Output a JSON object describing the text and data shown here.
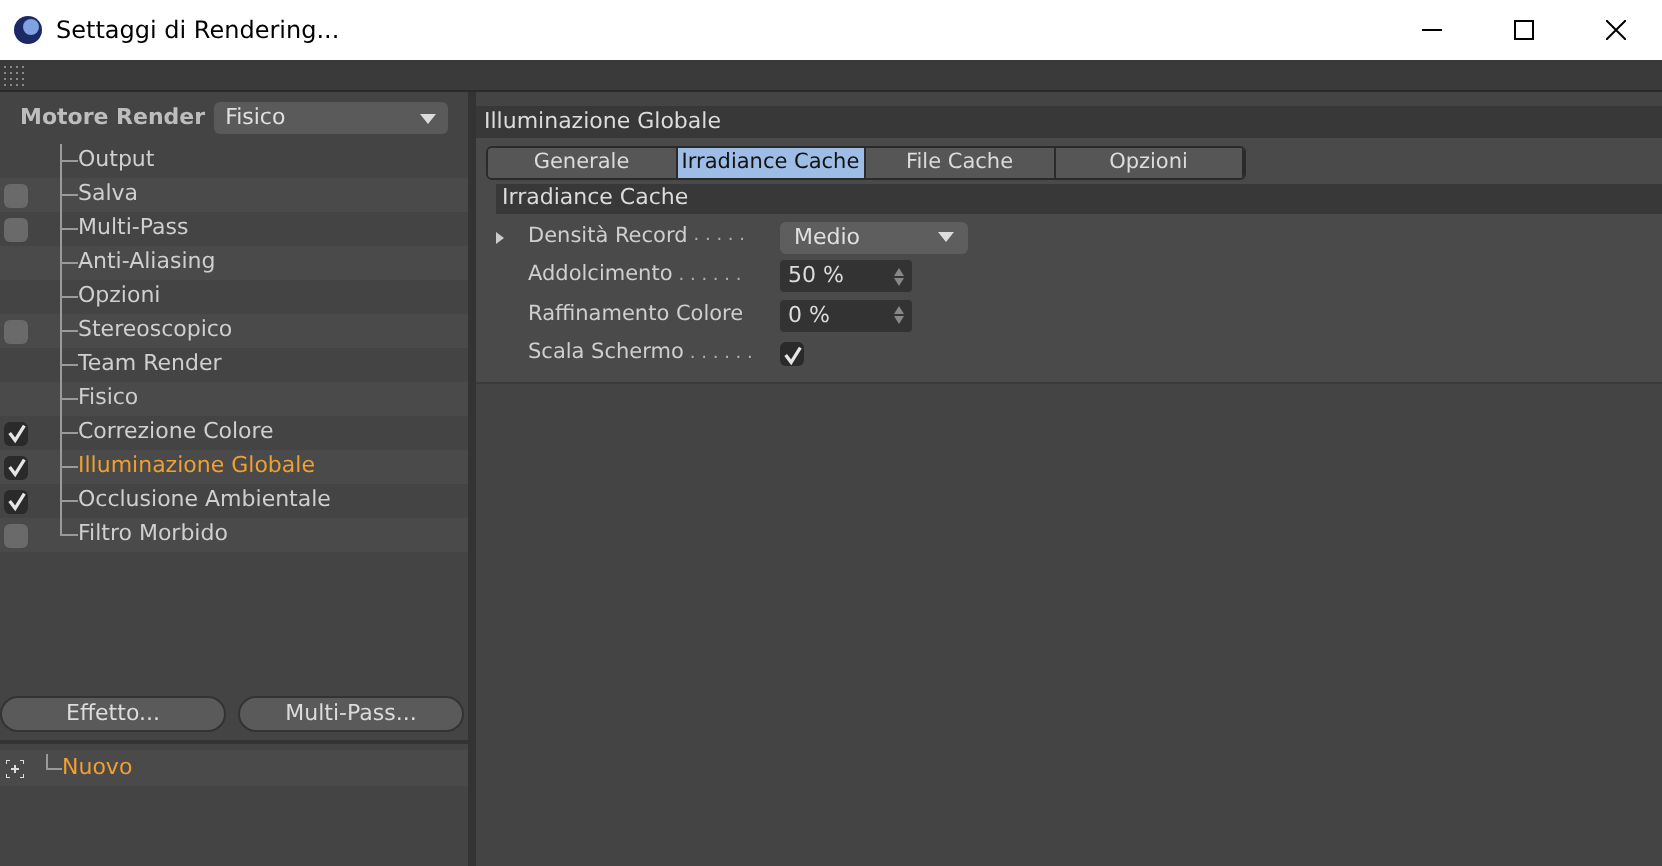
{
  "window": {
    "title": "Settaggi di Rendering..."
  },
  "renderer": {
    "label": "Motore Render",
    "value": "Fisico"
  },
  "tree": [
    {
      "label": "Output",
      "kind": "plain",
      "selected": false
    },
    {
      "label": "Salva",
      "kind": "check",
      "checked": false,
      "selected": false
    },
    {
      "label": "Multi-Pass",
      "kind": "check",
      "checked": false,
      "selected": false
    },
    {
      "label": "Anti-Aliasing",
      "kind": "plain",
      "selected": false
    },
    {
      "label": "Opzioni",
      "kind": "plain",
      "selected": false
    },
    {
      "label": "Stereoscopico",
      "kind": "check",
      "checked": false,
      "selected": false
    },
    {
      "label": "Team Render",
      "kind": "plain",
      "selected": false
    },
    {
      "label": "Fisico",
      "kind": "plain",
      "selected": false
    },
    {
      "label": "Correzione Colore",
      "kind": "check",
      "checked": true,
      "selected": false
    },
    {
      "label": "Illuminazione Globale",
      "kind": "check",
      "checked": true,
      "selected": true
    },
    {
      "label": "Occlusione Ambientale",
      "kind": "check",
      "checked": true,
      "selected": false
    },
    {
      "label": "Filtro Morbido",
      "kind": "check",
      "checked": false,
      "selected": false
    }
  ],
  "buttons": [
    "Effetto...",
    "Multi-Pass..."
  ],
  "presets": [
    {
      "label": "Nuovo"
    }
  ],
  "panel": {
    "title": "Illuminazione Globale",
    "tabs": [
      {
        "label": "Generale",
        "selected": false
      },
      {
        "label": "Irradiance Cache",
        "selected": true
      },
      {
        "label": "File Cache",
        "selected": false
      },
      {
        "label": "Opzioni",
        "selected": false
      }
    ],
    "section": "Irradiance Cache",
    "params": [
      {
        "kind": "dropdown",
        "label": "Densità Record",
        "dots": ". . . . .",
        "value": "Medio"
      },
      {
        "kind": "number",
        "label": "Addolcimento",
        "dots": ". . . . . .",
        "value": "50 %"
      },
      {
        "kind": "number",
        "label": "Raffinamento Colore",
        "value": "0 %"
      },
      {
        "kind": "check",
        "label": "Scala Schermo",
        "dots": ". . . . . .",
        "checked": true
      }
    ]
  }
}
